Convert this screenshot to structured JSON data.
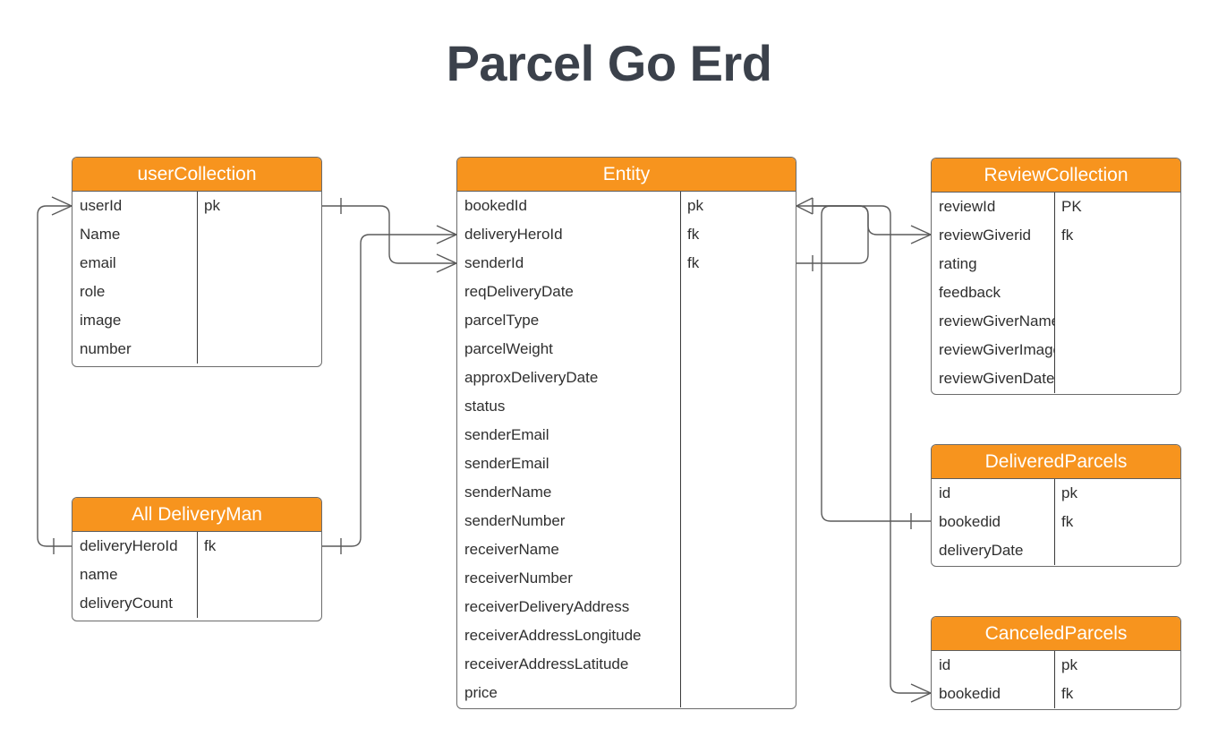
{
  "title": "Parcel Go Erd",
  "theme": {
    "header_fill": "#f7941e",
    "header_text": "#ffffff",
    "border": "#6b6b6b",
    "body_text": "#2f2f2f",
    "title_color": "#3b414b",
    "connector": "#5a5a5a",
    "background": "#ffffff"
  },
  "entities": [
    {
      "id": "userCollection",
      "name": "userCollection",
      "attributes": [
        {
          "name": "userId",
          "key": "pk"
        },
        {
          "name": "Name",
          "key": ""
        },
        {
          "name": "email",
          "key": ""
        },
        {
          "name": "role",
          "key": ""
        },
        {
          "name": "image",
          "key": ""
        },
        {
          "name": "number",
          "key": ""
        }
      ]
    },
    {
      "id": "allDeliveryMan",
      "name": "All DeliveryMan",
      "attributes": [
        {
          "name": "deliveryHeroId",
          "key": "fk"
        },
        {
          "name": "name",
          "key": ""
        },
        {
          "name": "deliveryCount",
          "key": ""
        }
      ]
    },
    {
      "id": "entity",
      "name": "Entity",
      "attributes": [
        {
          "name": "bookedId",
          "key": "pk"
        },
        {
          "name": "deliveryHeroId",
          "key": "fk"
        },
        {
          "name": "senderId",
          "key": "fk"
        },
        {
          "name": "reqDeliveryDate",
          "key": ""
        },
        {
          "name": "parcelType",
          "key": ""
        },
        {
          "name": "parcelWeight",
          "key": ""
        },
        {
          "name": "approxDeliveryDate",
          "key": ""
        },
        {
          "name": "status",
          "key": ""
        },
        {
          "name": "senderEmail",
          "key": ""
        },
        {
          "name": "senderEmail",
          "key": ""
        },
        {
          "name": "senderName",
          "key": ""
        },
        {
          "name": "senderNumber",
          "key": ""
        },
        {
          "name": "receiverName",
          "key": ""
        },
        {
          "name": "receiverNumber",
          "key": ""
        },
        {
          "name": "receiverDeliveryAddress",
          "key": ""
        },
        {
          "name": "receiverAddressLongitude",
          "key": ""
        },
        {
          "name": "receiverAddressLatitude",
          "key": ""
        },
        {
          "name": "price",
          "key": ""
        }
      ]
    },
    {
      "id": "reviewCollection",
      "name": "ReviewCollection",
      "attributes": [
        {
          "name": "reviewId",
          "key": "PK"
        },
        {
          "name": "reviewGiverid",
          "key": "fk"
        },
        {
          "name": "rating",
          "key": ""
        },
        {
          "name": "feedback",
          "key": ""
        },
        {
          "name": "reviewGiverName",
          "key": ""
        },
        {
          "name": "reviewGiverImage",
          "key": ""
        },
        {
          "name": "reviewGivenDate",
          "key": ""
        }
      ]
    },
    {
      "id": "deliveredParcels",
      "name": "DeliveredParcels",
      "attributes": [
        {
          "name": "id",
          "key": "pk"
        },
        {
          "name": "bookedid",
          "key": "fk"
        },
        {
          "name": "deliveryDate",
          "key": ""
        }
      ]
    },
    {
      "id": "canceledParcels",
      "name": "CanceledParcels",
      "attributes": [
        {
          "name": "id",
          "key": "pk"
        },
        {
          "name": "bookedid",
          "key": "fk"
        }
      ]
    }
  ],
  "relationships": [
    {
      "id": "rel-user-deliveryman",
      "from": "userCollection.userId",
      "to": "allDeliveryMan.deliveryHeroId",
      "from_marker": "crows-foot",
      "to_marker": "one-bar"
    },
    {
      "id": "rel-user-entity",
      "from": "userCollection.userId",
      "to": "entity.senderId",
      "from_marker": "one-bar",
      "to_marker": "crows-foot"
    },
    {
      "id": "rel-deliveryman-entity",
      "from": "allDeliveryMan.deliveryHeroId",
      "to": "entity.deliveryHeroId",
      "from_marker": "one-bar",
      "to_marker": "crows-foot"
    },
    {
      "id": "rel-entity-review",
      "from": "entity.bookedId",
      "to": "reviewCollection.reviewGiverid",
      "from_marker": "crows-foot",
      "to_marker": "crows-foot"
    },
    {
      "id": "rel-entity-delivered",
      "from": "entity.bookedId",
      "to": "deliveredParcels.bookedid",
      "from_marker": "one-bar",
      "to_marker": "one-bar"
    },
    {
      "id": "rel-entity-canceled",
      "from": "entity.bookedId",
      "to": "canceledParcels.bookedid",
      "from_marker": "one-bar",
      "to_marker": "crows-foot"
    }
  ]
}
